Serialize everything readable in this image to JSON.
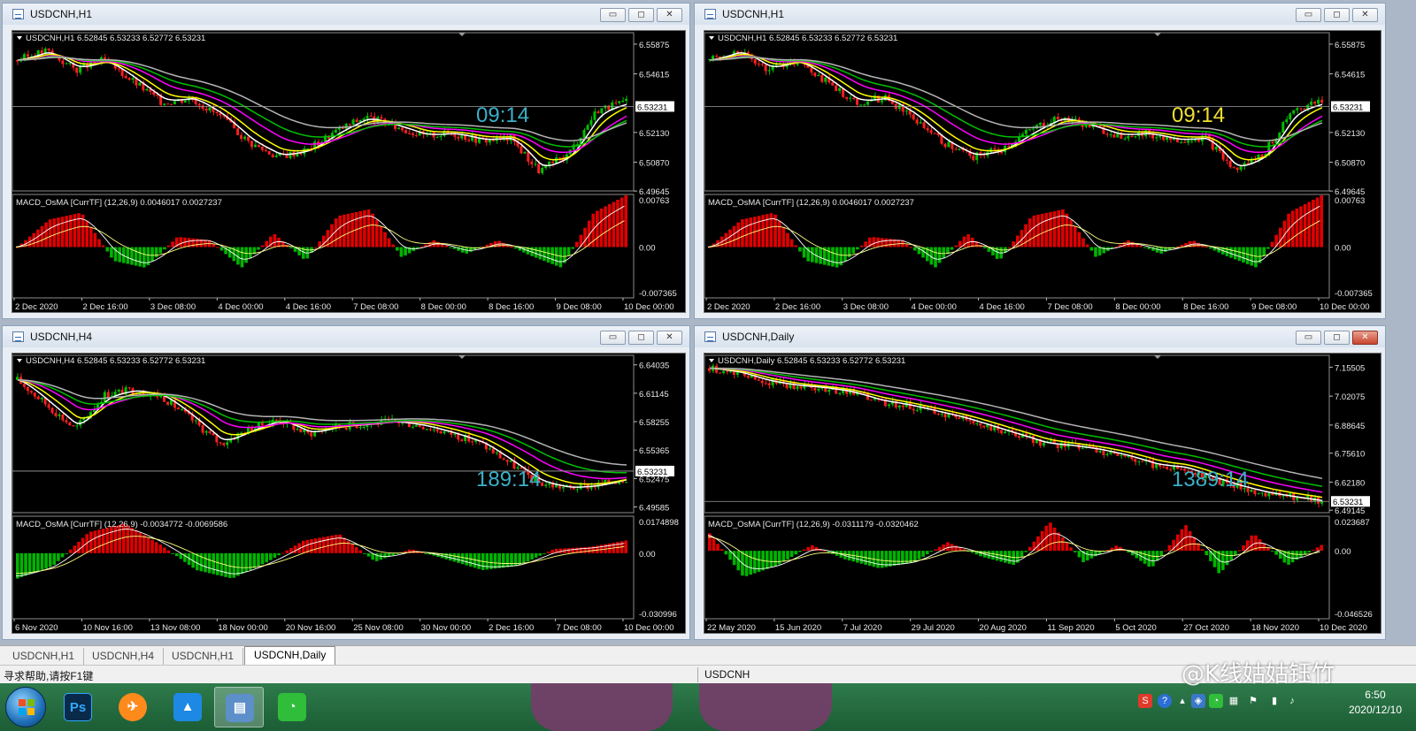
{
  "taskbar_tabs": [
    "USDCNH,H1",
    "USDCNH,H4",
    "USDCNH,H1",
    "USDCNH,Daily"
  ],
  "status": {
    "help": "寻求帮助,请按F1键",
    "symbol": "USDCNH"
  },
  "clock": {
    "time": "6:50",
    "date": "2020/12/10"
  },
  "watermark": "@K线姑姑钰竹",
  "window_buttons": {
    "minimize": "▭",
    "maximize": "◻",
    "close": "✕"
  },
  "colors": {
    "bull": "#00c000",
    "bear": "#ff2020",
    "ma_white": "#ffffff",
    "ma_yellow": "#ffff00",
    "ma_magenta": "#ff00ff",
    "ma_green": "#00c000",
    "ma_gray": "#b4b4b4",
    "hist_pos": "#e00000",
    "hist_neg": "#00b400",
    "timer_cyan": "#3ab0c8",
    "timer_yellow": "#f0e030"
  },
  "charts": [
    {
      "id": "tl",
      "window_title": "USDCNH,H1",
      "header": "USDCNH,H1  6.52845 6.53233 6.52772 6.53231",
      "price_ticks": [
        "6.55875",
        "6.54615",
        "6.53231",
        "6.52130",
        "6.50870",
        "6.49645"
      ],
      "current_price": "6.53231",
      "timer": "09:14",
      "timer_color": "#3ab0c8",
      "macd_header": "MACD_OsMA [CurrTF] (12,26,9) 0.0046017 0.0027237",
      "macd_ticks": [
        "0.00763",
        "0.00",
        "-0.007365"
      ],
      "time_labels": [
        "2 Dec 2020",
        "2 Dec 16:00",
        "3 Dec 08:00",
        "4 Dec 00:00",
        "4 Dec 16:00",
        "7 Dec 08:00",
        "8 Dec 00:00",
        "8 Dec 16:00",
        "9 Dec 08:00",
        "10 Dec 00:00"
      ],
      "chart_data": {
        "type": "candlestick",
        "y_range": [
          6.4965,
          6.5636
        ],
        "close_points": [
          6.552,
          6.556,
          6.548,
          6.552,
          6.543,
          6.534,
          6.536,
          6.528,
          6.517,
          6.511,
          6.514,
          6.522,
          6.528,
          6.524,
          6.52,
          6.521,
          6.518,
          6.519,
          6.505,
          6.512,
          6.531,
          6.534
        ],
        "macd_hist": [
          0.0,
          0.004,
          0.005,
          -0.002,
          -0.003,
          0.0015,
          0.001,
          -0.003,
          0.002,
          -0.002,
          0.0045,
          0.0055,
          -0.0015,
          0.001,
          -0.001,
          0.001,
          -0.0012,
          -0.003,
          0.005,
          0.0075
        ],
        "macd_range": [
          -0.007365,
          0.00763
        ]
      }
    },
    {
      "id": "tr",
      "window_title": "USDCNH,H1",
      "header": "USDCNH,H1  6.52845 6.53233 6.52772 6.53231",
      "price_ticks": [
        "6.55875",
        "6.54615",
        "6.53231",
        "6.52130",
        "6.50870",
        "6.49645"
      ],
      "current_price": "6.53231",
      "timer": "09:14",
      "timer_color": "#f0e030",
      "macd_header": "MACD_OsMA [CurrTF] (12,26,9) 0.0046017 0.0027237",
      "macd_ticks": [
        "0.00763",
        "0.00",
        "-0.007365"
      ],
      "time_labels": [
        "2 Dec 2020",
        "2 Dec 16:00",
        "3 Dec 08:00",
        "4 Dec 00:00",
        "4 Dec 16:00",
        "7 Dec 08:00",
        "8 Dec 00:00",
        "8 Dec 16:00",
        "9 Dec 08:00",
        "10 Dec 00:00"
      ],
      "chart_data": {
        "type": "candlestick",
        "y_range": [
          6.4965,
          6.5636
        ],
        "close_points": [
          6.552,
          6.556,
          6.548,
          6.552,
          6.543,
          6.534,
          6.536,
          6.528,
          6.517,
          6.511,
          6.514,
          6.522,
          6.528,
          6.524,
          6.52,
          6.521,
          6.518,
          6.519,
          6.505,
          6.512,
          6.531,
          6.534
        ],
        "macd_hist": [
          0.0,
          0.004,
          0.005,
          -0.002,
          -0.003,
          0.0015,
          0.001,
          -0.003,
          0.002,
          -0.002,
          0.0045,
          0.0055,
          -0.0015,
          0.001,
          -0.001,
          0.001,
          -0.0012,
          -0.003,
          0.005,
          0.0075
        ],
        "macd_range": [
          -0.007365,
          0.00763
        ]
      }
    },
    {
      "id": "bl",
      "window_title": "USDCNH,H4",
      "header": "USDCNH,H4  6.52845 6.53233 6.52772 6.53231",
      "price_ticks": [
        "6.64035",
        "6.61145",
        "6.58255",
        "6.55365",
        "6.53231",
        "6.52475",
        "6.49585"
      ],
      "current_price": "6.53231",
      "timer": "189:14",
      "timer_color": "#3ab0c8",
      "macd_header": "MACD_OsMA [CurrTF] (12,26,9) -0.0034772 -0.0069586",
      "macd_ticks": [
        "0.0174898",
        "0.00",
        "-0.030996"
      ],
      "time_labels": [
        "6 Nov 2020",
        "10 Nov 16:00",
        "13 Nov 08:00",
        "18 Nov 00:00",
        "20 Nov 16:00",
        "25 Nov 08:00",
        "30 Nov 00:00",
        "2 Dec 16:00",
        "7 Dec 08:00",
        "10 Dec 00:00"
      ],
      "chart_data": {
        "type": "candlestick",
        "y_range": [
          6.49,
          6.65
        ],
        "close_points": [
          6.625,
          6.6,
          6.575,
          6.61,
          6.615,
          6.608,
          6.585,
          6.56,
          6.575,
          6.585,
          6.57,
          6.578,
          6.58,
          6.583,
          6.578,
          6.57,
          6.56,
          6.54,
          6.52,
          6.515,
          6.518,
          6.525
        ],
        "macd_hist": [
          -0.012,
          -0.006,
          0.01,
          0.014,
          0.004,
          -0.008,
          -0.012,
          -0.004,
          0.006,
          0.009,
          -0.004,
          0.002,
          -0.003,
          -0.008,
          -0.006,
          0.002,
          0.003,
          0.006
        ],
        "macd_range": [
          -0.030996,
          0.0174898
        ]
      }
    },
    {
      "id": "br",
      "window_title": "USDCNH,Daily",
      "header": "USDCNH,Daily  6.52845 6.53233 6.52772 6.53231",
      "price_ticks": [
        "7.15505",
        "7.02075",
        "6.88645",
        "6.75610",
        "6.62180",
        "6.53231",
        "6.49145"
      ],
      "current_price": "6.53231",
      "timer": "1389:14",
      "timer_color": "#3ab0c8",
      "macd_header": "MACD_OsMA [CurrTF] (12,26,9) -0.0311179 -0.0320462",
      "macd_ticks": [
        "0.023687",
        "0.00",
        "-0.046526"
      ],
      "time_labels": [
        "22 May 2020",
        "15 Jun 2020",
        "7 Jul 2020",
        "29 Jul 2020",
        "20 Aug 2020",
        "11 Sep 2020",
        "5 Oct 2020",
        "27 Oct 2020",
        "18 Nov 2020",
        "10 Dec 2020"
      ],
      "chart_data": {
        "type": "candlestick",
        "y_range": [
          6.48,
          7.21
        ],
        "close_points": [
          7.15,
          7.13,
          7.09,
          7.07,
          7.06,
          7.04,
          7.0,
          6.98,
          6.95,
          6.92,
          6.88,
          6.84,
          6.8,
          6.79,
          6.77,
          6.74,
          6.7,
          6.69,
          6.64,
          6.6,
          6.57,
          6.55,
          6.532
        ],
        "macd_hist": [
          0.012,
          -0.018,
          -0.01,
          0.004,
          -0.006,
          -0.012,
          -0.008,
          0.006,
          -0.004,
          -0.01,
          0.02,
          -0.008,
          0.004,
          -0.012,
          0.018,
          -0.016,
          0.012,
          -0.01,
          0.004
        ],
        "macd_range": [
          -0.046526,
          0.023687
        ]
      }
    }
  ]
}
